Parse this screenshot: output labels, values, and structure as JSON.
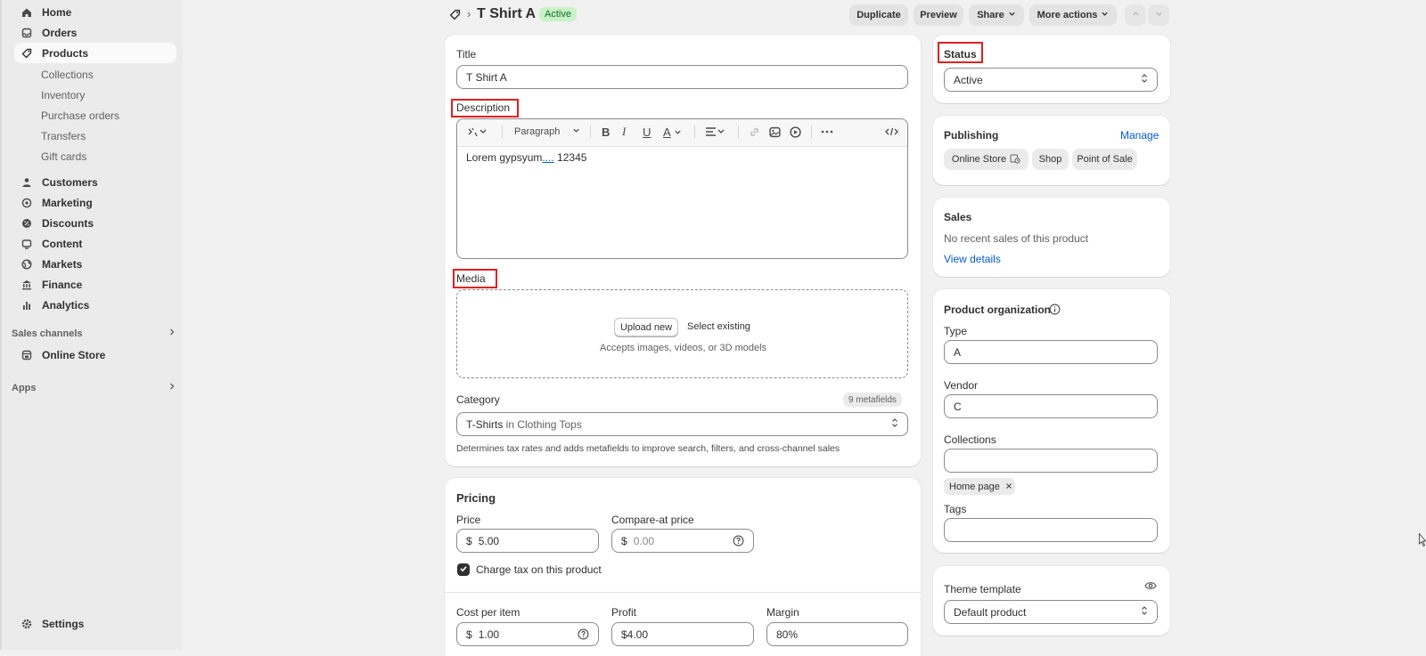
{
  "nav": {
    "home": "Home",
    "orders": "Orders",
    "products": "Products",
    "products_sub": [
      "Collections",
      "Inventory",
      "Purchase orders",
      "Transfers",
      "Gift cards"
    ],
    "customers": "Customers",
    "marketing": "Marketing",
    "discounts": "Discounts",
    "content": "Content",
    "markets": "Markets",
    "finance": "Finance",
    "analytics": "Analytics",
    "sales_channels": "Sales channels",
    "online_store": "Online Store",
    "apps": "Apps",
    "settings": "Settings"
  },
  "header": {
    "title": "T Shirt A",
    "status_badge": "Active",
    "duplicate": "Duplicate",
    "preview": "Preview",
    "share": "Share",
    "more_actions": "More actions"
  },
  "main": {
    "title_label": "Title",
    "title_value": "T Shirt A",
    "description_label": "Description",
    "toolbar_paragraph": "Paragraph",
    "description_text": "Lorem gypsyum",
    "description_link": "....",
    "description_tail": " 12345",
    "media_label": "Media",
    "upload_new": "Upload new",
    "select_existing": "Select existing",
    "media_hint": "Accepts images, videos, or 3D models",
    "category_label": "Category",
    "metafields_badge": "9 metafields",
    "category_value": "T-Shirts",
    "category_in": " in Clothing Tops",
    "category_hint": "Determines tax rates and adds metafields to improve search, filters, and cross-channel sales"
  },
  "pricing": {
    "heading": "Pricing",
    "price_label": "Price",
    "currency": "$",
    "price_value": "5.00",
    "compare_label": "Compare-at price",
    "compare_value": "0.00",
    "charge_tax": "Charge tax on this product",
    "cost_label": "Cost per item",
    "cost_value": "1.00",
    "profit_label": "Profit",
    "profit_value": "$4.00",
    "margin_label": "Margin",
    "margin_value": "80%"
  },
  "side": {
    "status_label": "Status",
    "status_value": "Active",
    "publishing_label": "Publishing",
    "manage": "Manage",
    "channels": [
      "Online Store",
      "Shop",
      "Point of Sale"
    ],
    "sales_label": "Sales",
    "sales_text": "No recent sales of this product",
    "view_details": "View details",
    "org_label": "Product organization",
    "type_label": "Type",
    "type_value": "A",
    "vendor_label": "Vendor",
    "vendor_value": "C",
    "collections_label": "Collections",
    "collection_tag": "Home page",
    "tags_label": "Tags",
    "theme_label": "Theme template",
    "theme_value": "Default product"
  },
  "colors": {
    "accent_link": "#005bd3",
    "annotation_red": "#e02020",
    "active_badge_bg": "#c9f2c9"
  }
}
